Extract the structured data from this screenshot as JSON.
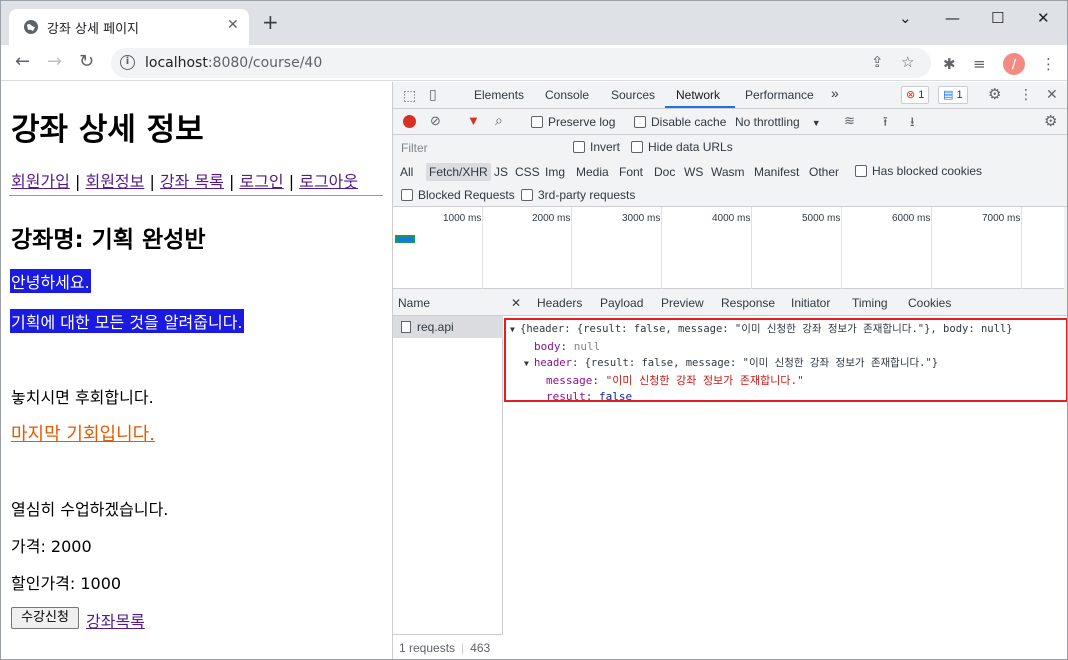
{
  "browser": {
    "tab_title": "강좌 상세 페이지",
    "url_host": "localhost",
    "url_rest": ":8080/course/40"
  },
  "page": {
    "title": "강좌 상세 정보",
    "nav_links": [
      "회원가입",
      "회원정보",
      "강좌 목록",
      "로그인",
      "로그아웃"
    ],
    "separator": "|",
    "course_name": "강좌명: 기획 완성반",
    "highlight1": "안녕하세요.",
    "highlight2": "기획에 대한 모든 것을 알려줍니다.",
    "text1": "놓치시면 후회합니다.",
    "orange_text": "마지막 기회입니다.",
    "text2": "열심히 수업하겠습니다.",
    "price": "가격: 2000",
    "sale_price": "할인가격: 1000",
    "apply_button": "수강신청",
    "list_link": "강좌목록"
  },
  "devtools": {
    "tabs": [
      "Elements",
      "Console",
      "Sources",
      "Network",
      "Performance"
    ],
    "active_tab": "Network",
    "error_count": "1",
    "message_count": "1",
    "toolbar": {
      "preserve_log": "Preserve log",
      "disable_cache": "Disable cache",
      "throttling": "No throttling"
    },
    "filter": {
      "placeholder": "Filter",
      "invert": "Invert",
      "hide_data_urls": "Hide data URLs",
      "types": [
        "All",
        "Fetch/XHR",
        "JS",
        "CSS",
        "Img",
        "Media",
        "Font",
        "Doc",
        "WS",
        "Wasm",
        "Manifest",
        "Other"
      ],
      "selected_type": "Fetch/XHR",
      "has_blocked_cookies": "Has blocked cookies",
      "blocked_requests": "Blocked Requests",
      "third_party": "3rd-party requests"
    },
    "timeline_ticks": [
      "1000 ms",
      "2000 ms",
      "3000 ms",
      "4000 ms",
      "5000 ms",
      "6000 ms",
      "7000 ms"
    ],
    "name_header": "Name",
    "request_name": "req.api",
    "status": {
      "requests": "1 requests",
      "size": "463"
    },
    "detail_tabs": [
      "Headers",
      "Payload",
      "Preview",
      "Response",
      "Initiator",
      "Timing",
      "Cookies"
    ],
    "preview": {
      "line1": "{header: {result: false, message: \"이미 신청한 강좌 정보가 존재합니다.\"}, body: null}",
      "body_key": "body",
      "body_val": "null",
      "header_key": "header",
      "header_val": "{result: false, message: \"이미 신청한 강좌 정보가 존재합니다.\"}",
      "message_key": "message",
      "message_val": "\"이미 신청한 강좌 정보가 존재합니다.\"",
      "result_key": "result",
      "result_val": "false"
    }
  }
}
